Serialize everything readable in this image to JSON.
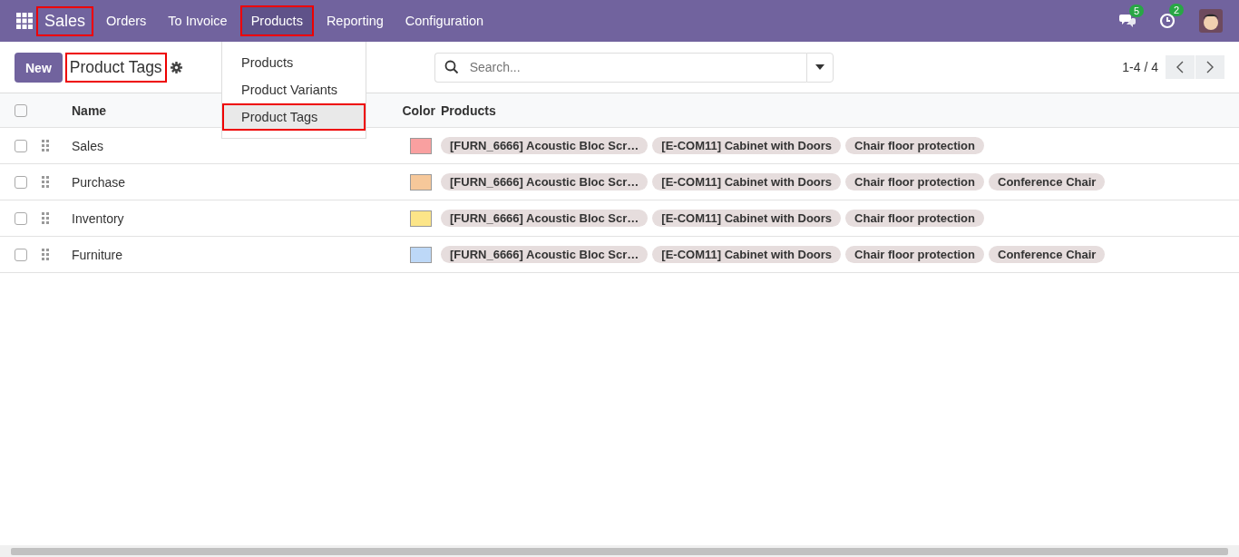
{
  "navbar": {
    "app_name": {
      "label": "Sales",
      "highlighted": true
    },
    "menu": [
      {
        "label": "Orders",
        "open": false,
        "highlighted": false
      },
      {
        "label": "To Invoice",
        "open": false,
        "highlighted": false
      },
      {
        "label": "Products",
        "open": true,
        "highlighted": true
      },
      {
        "label": "Reporting",
        "open": false,
        "highlighted": false
      },
      {
        "label": "Configuration",
        "open": false,
        "highlighted": false
      }
    ],
    "messages_badge": "5",
    "activities_badge": "2"
  },
  "dropdown": [
    {
      "label": "Products",
      "selected": false,
      "highlighted": false
    },
    {
      "label": "Product Variants",
      "selected": false,
      "highlighted": false
    },
    {
      "label": "Product Tags",
      "selected": true,
      "highlighted": true
    }
  ],
  "control_panel": {
    "new_button": "New",
    "title": {
      "label": "Product Tags",
      "highlighted": true
    },
    "search": {
      "placeholder": "Search..."
    },
    "pager": "1-4 / 4"
  },
  "table": {
    "select_all_checked": false,
    "columns": [
      "Name",
      "Color",
      "Products"
    ],
    "rows": [
      {
        "name": "Sales",
        "checked": false,
        "color": "#f9a0a0",
        "products": [
          "[FURN_6666] Acoustic Bloc Scr…",
          "[E-COM11] Cabinet with Doors",
          "Chair floor protection"
        ]
      },
      {
        "name": "Purchase",
        "checked": false,
        "color": "#f6c89a",
        "products": [
          "[FURN_6666] Acoustic Bloc Scr…",
          "[E-COM11] Cabinet with Doors",
          "Chair floor protection",
          "Conference Chair"
        ]
      },
      {
        "name": "Inventory",
        "checked": false,
        "color": "#fce588",
        "products": [
          "[FURN_6666] Acoustic Bloc Scr…",
          "[E-COM11] Cabinet with Doors",
          "Chair floor protection"
        ]
      },
      {
        "name": "Furniture",
        "checked": false,
        "color": "#bdd8f7",
        "products": [
          "[FURN_6666] Acoustic Bloc Scr…",
          "[E-COM11] Cabinet with Doors",
          "Chair floor protection",
          "Conference Chair"
        ]
      }
    ]
  }
}
